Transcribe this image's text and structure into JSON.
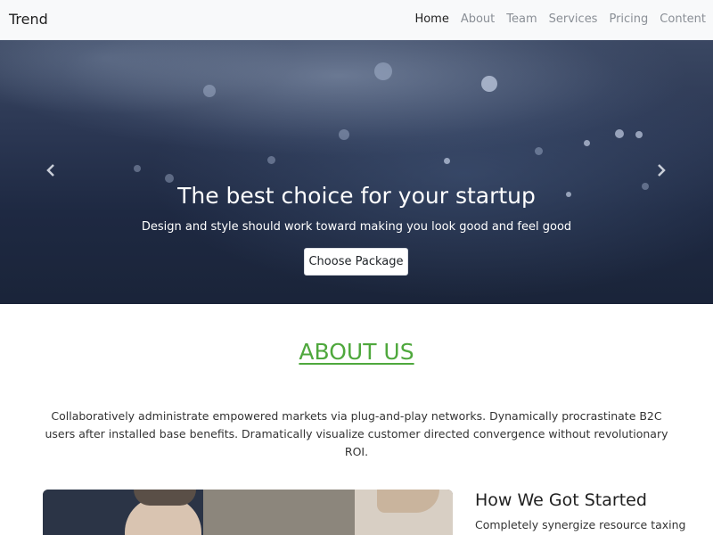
{
  "navbar": {
    "brand": "Trend",
    "items": [
      {
        "label": "Home",
        "active": true
      },
      {
        "label": "About",
        "active": false
      },
      {
        "label": "Team",
        "active": false
      },
      {
        "label": "Services",
        "active": false
      },
      {
        "label": "Pricing",
        "active": false
      },
      {
        "label": "Content",
        "active": false
      }
    ]
  },
  "hero": {
    "title": "The best choice for your startup",
    "subtitle": "Design and style should work toward making you look good and feel good",
    "button_label": "Choose Package",
    "prev_icon": "chevron-left-icon",
    "next_icon": "chevron-right-icon"
  },
  "about": {
    "title": "ABOUT US",
    "text": "Collaboratively administrate empowered markets via plug-and-play networks. Dynamically procrastinate B2C users after installed base benefits. Dramatically visualize customer directed convergence without revolutionary ROI."
  },
  "started": {
    "title": "How We Got Started",
    "text": "Completely synergize resource taxing"
  },
  "colors": {
    "accent": "#4fa83d",
    "navbar_bg": "#f8f9fa",
    "hero_bg": "#1e2942"
  }
}
